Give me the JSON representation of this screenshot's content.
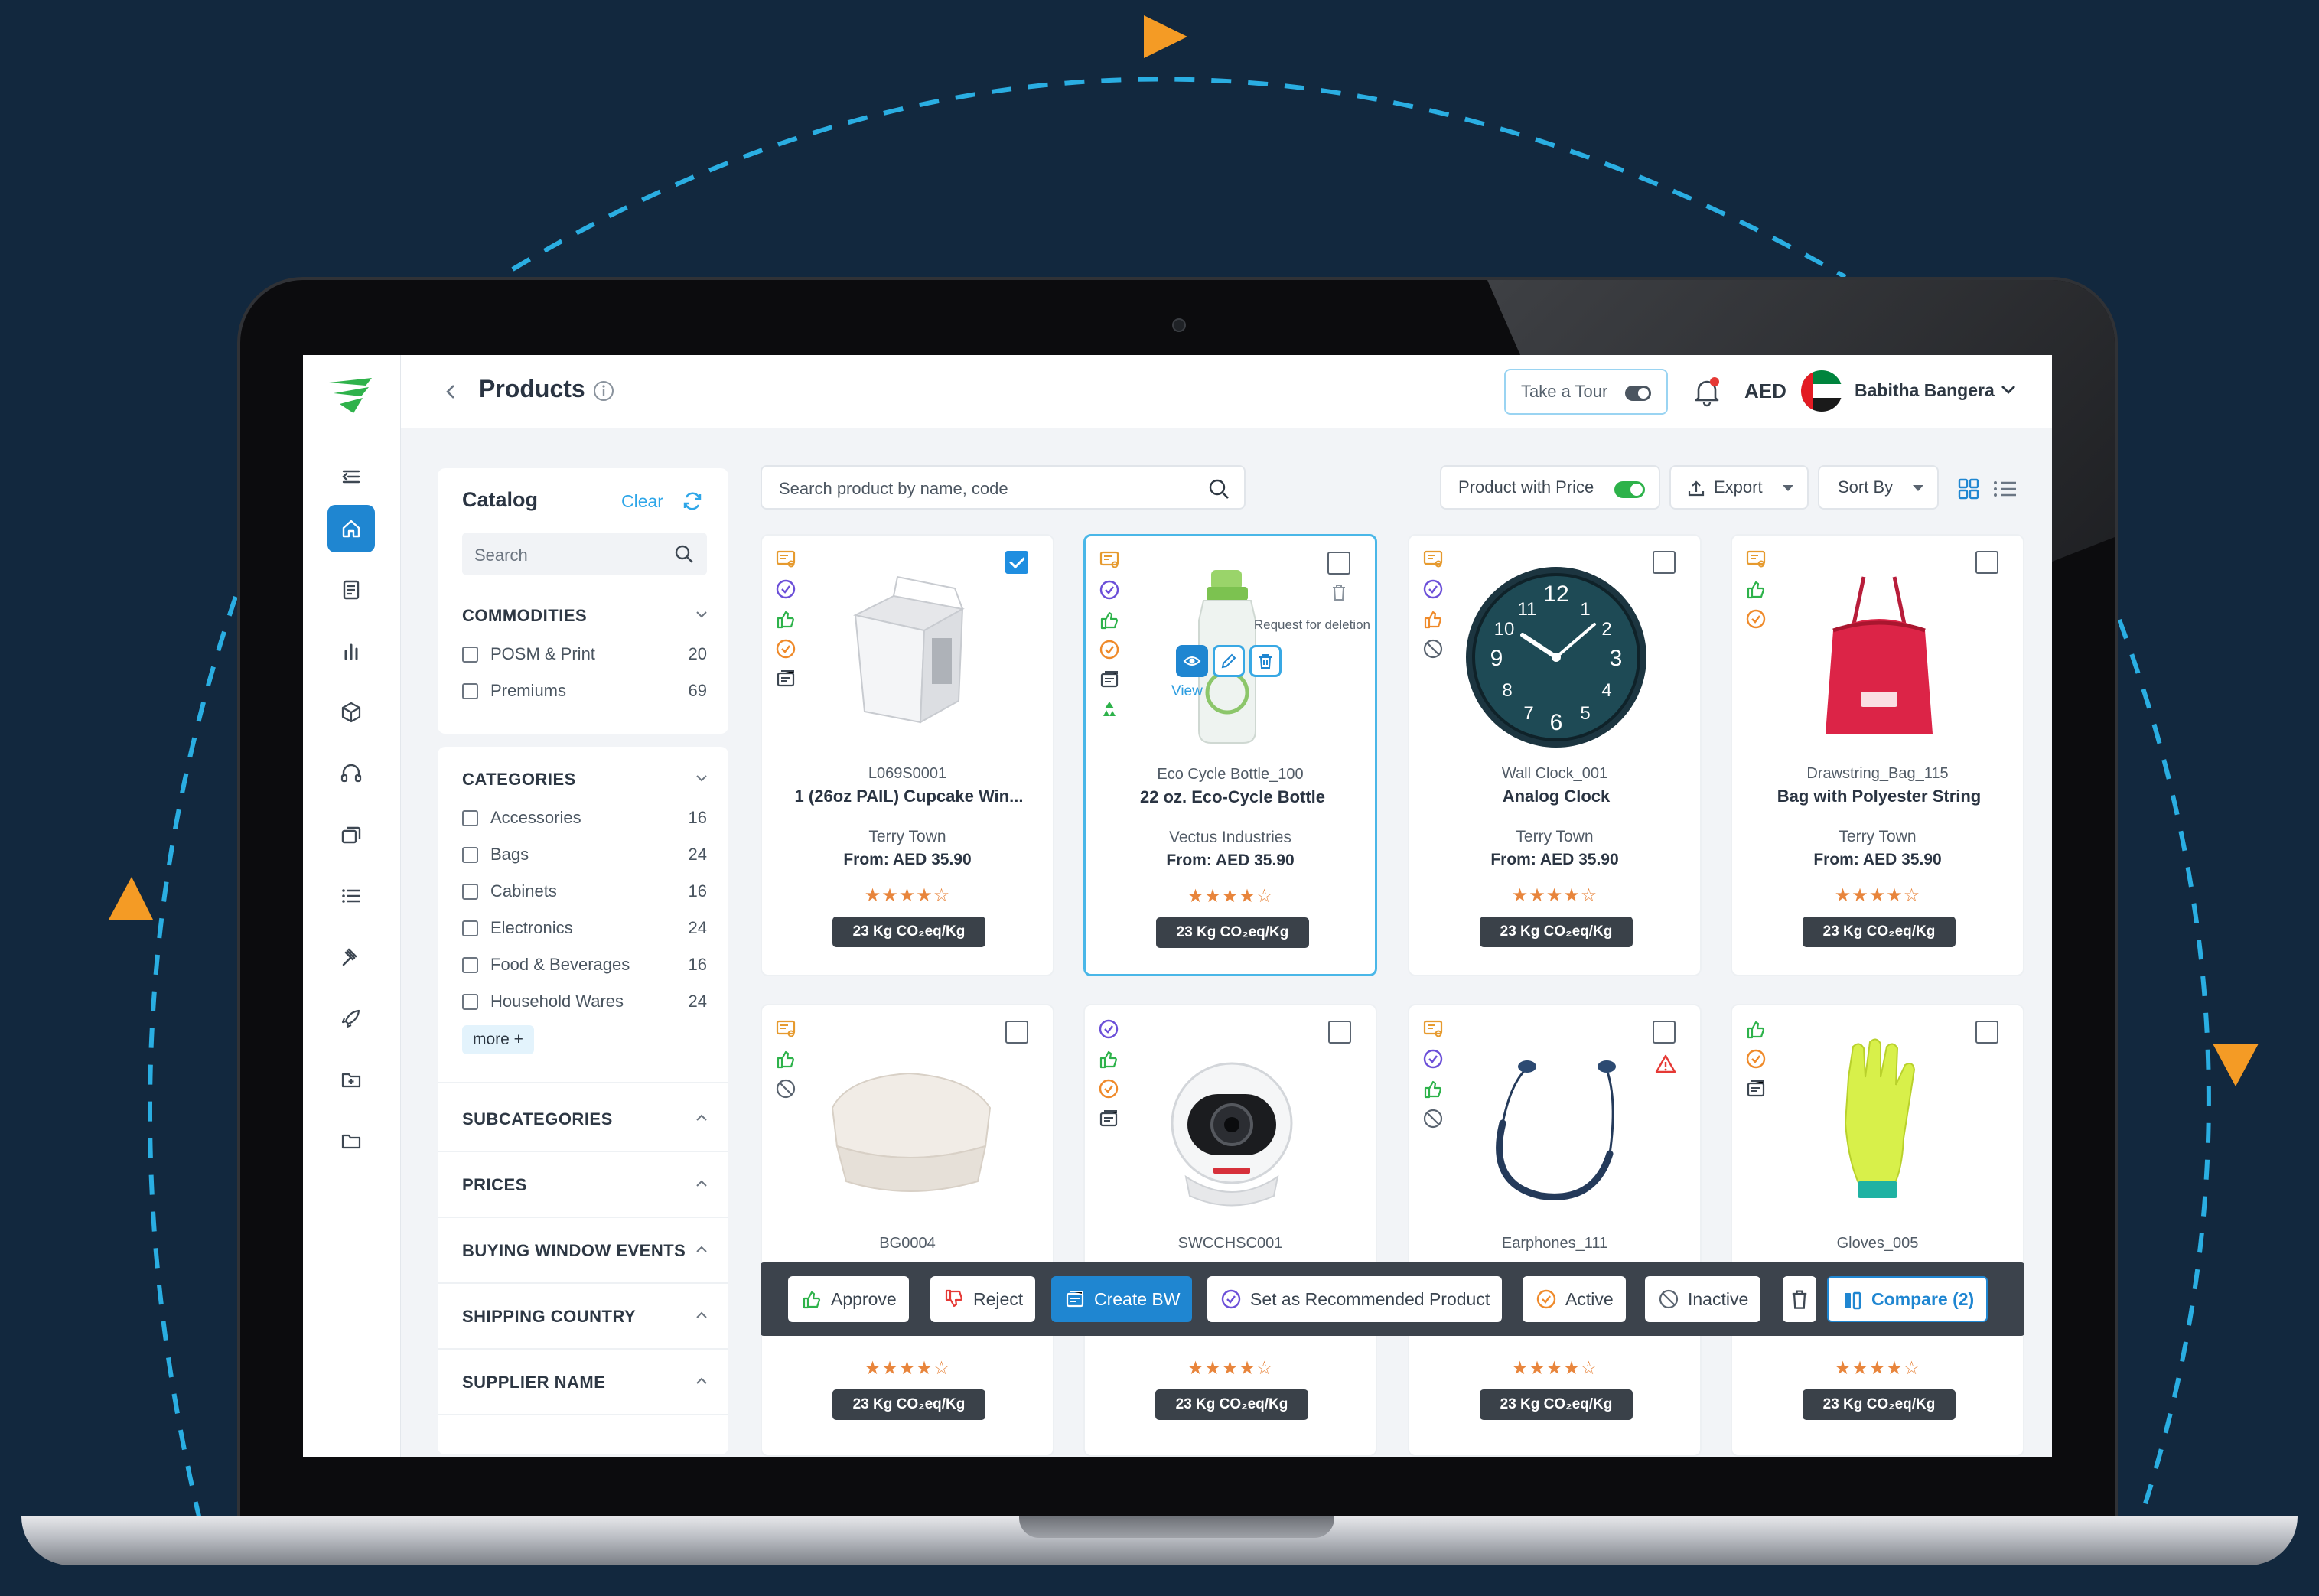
{
  "colors": {
    "background": "#12283e",
    "accent": "#1f86d1",
    "dash": "#2aaee2",
    "arrow": "#f49b25",
    "co2_badge": "#3a4149",
    "star": "#e8853c"
  },
  "header": {
    "back_icon": "chevron-left-icon",
    "title": "Products",
    "tour_label": "Take a Tour",
    "currency": "AED",
    "user_name": "Babitha Bangera"
  },
  "sidebar": {
    "items": [
      "collapse-icon",
      "home-icon",
      "document-icon",
      "bar-chart-icon",
      "cube-icon",
      "headset-icon",
      "layers-icon",
      "list-icon",
      "gavel-icon",
      "rocket-icon",
      "folder-plus-icon",
      "folder-icon"
    ],
    "active_index": 1
  },
  "filters": {
    "title": "Catalog",
    "clear_label": "Clear",
    "search_placeholder": "Search",
    "commodities": {
      "title": "COMMODITIES",
      "items": [
        {
          "label": "POSM & Print",
          "count": "20"
        },
        {
          "label": "Premiums",
          "count": "69"
        }
      ]
    },
    "categories": {
      "title": "CATEGORIES",
      "items": [
        {
          "label": "Accessories",
          "count": "16"
        },
        {
          "label": "Bags",
          "count": "24"
        },
        {
          "label": "Cabinets",
          "count": "16"
        },
        {
          "label": "Electronics",
          "count": "24"
        },
        {
          "label": "Food & Beverages",
          "count": "16"
        },
        {
          "label": "Household Wares",
          "count": "24"
        }
      ],
      "more_label": "more +"
    },
    "sections": [
      "SUBCATEGORIES",
      "PRICES",
      "BUYING WINDOW EVENTS",
      "SHIPPING COUNTRY",
      "SUPPLIER NAME"
    ]
  },
  "toolbar": {
    "search_placeholder": "Search product by name, code",
    "product_with_price": "Product with Price",
    "export_label": "Export",
    "sort_label": "Sort By"
  },
  "products": [
    {
      "code": "L069S0001",
      "name": "1 (26oz PAIL) Cupcake Win...",
      "supplier": "Terry Town",
      "price": "From: AED 35.90",
      "stars": "★★★★☆",
      "rating": 4,
      "co2": "23 Kg CO₂eq/Kg",
      "checked": true
    },
    {
      "code": "Eco Cycle Bottle_100",
      "name": "22 oz. Eco-Cycle Bottle",
      "supplier": "Vectus Industries",
      "price": "From: AED 35.90",
      "stars": "★★★★☆",
      "rating": 4,
      "co2": "23 Kg CO₂eq/Kg",
      "checked": false,
      "view_label": "View",
      "request_deletion": "Request for deletion"
    },
    {
      "code": "Wall Clock_001",
      "name": "Analog Clock",
      "supplier": "Terry Town",
      "price": "From: AED 35.90",
      "stars": "★★★★☆",
      "rating": 4,
      "co2": "23 Kg CO₂eq/Kg",
      "checked": false
    },
    {
      "code": "Drawstring_Bag_115",
      "name": "Bag with Polyester String",
      "supplier": "Terry Town",
      "price": "From: AED 35.90",
      "stars": "★★★★☆",
      "rating": 4,
      "co2": "23 Kg CO₂eq/Kg",
      "checked": false
    },
    {
      "code": "BG0004",
      "stars": "★★★★☆",
      "rating": 4,
      "co2": "23 Kg CO₂eq/Kg",
      "checked": false
    },
    {
      "code": "SWCCHSC001",
      "stars": "★★★★☆",
      "rating": 4,
      "co2": "23 Kg CO₂eq/Kg",
      "checked": false
    },
    {
      "code": "Earphones_111",
      "stars": "★★★★☆",
      "rating": 4,
      "co2": "23 Kg CO₂eq/Kg",
      "checked": false
    },
    {
      "code": "Gloves_005",
      "stars": "★★★★☆",
      "rating": 4,
      "co2": "23 Kg CO₂eq/Kg",
      "checked": false
    }
  ],
  "bulk_actions": {
    "approve": "Approve",
    "reject": "Reject",
    "create_bw": "Create BW",
    "recommend": "Set as Recommended Product",
    "active": "Active",
    "inactive": "Inactive",
    "compare": "Compare (2)"
  }
}
